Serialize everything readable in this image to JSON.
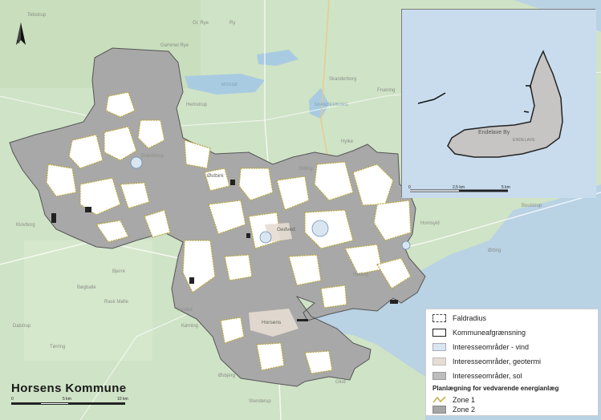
{
  "map": {
    "municipality_label": "Horsens",
    "places": [
      "Tebstrup",
      "Gammel Rye",
      "Ry",
      "Hemstrup",
      "Skanderborg",
      "Fruering",
      "Hylke",
      "Stilling",
      "Gedved",
      "Østbirk",
      "Brædstrup",
      "Klovborg",
      "Bjerre",
      "Hornsyld",
      "Ørting",
      "Hatting",
      "Torsted",
      "Kørning",
      "Rask Mølle",
      "Bøgballe",
      "Dalstrup",
      "Tørring",
      "Øsbjerg",
      "Glud",
      "Stenderup",
      "Gl. Rye",
      "Boulstrup"
    ],
    "lakes": [
      "MOSSØ",
      "SKANDERBORG"
    ]
  },
  "inset": {
    "place": "Endelave By",
    "sublabel": "ENDELAVE",
    "scale": {
      "labels": [
        "0",
        "2,5 km",
        "5 km"
      ]
    }
  },
  "brand": {
    "name": "Horsens Kommune"
  },
  "scalebar": {
    "labels": [
      "0",
      "5 km",
      "10 km"
    ]
  },
  "north": {
    "label": "N"
  },
  "legend": {
    "items": [
      {
        "label": "Faldradius",
        "swatch": "dashed"
      },
      {
        "label": "Kommuneafgrænsning",
        "swatch": "outline"
      },
      {
        "label": "Interesseområder - vind",
        "swatch": "#d9e6f2"
      },
      {
        "label": "Interesseområder, geotermi",
        "swatch": "#e6ddd2"
      },
      {
        "label": "Interesseområder, sol",
        "swatch": "#bdbdbd"
      }
    ],
    "section_title": "Planlægning for vedvarende energianlæg",
    "zones": [
      {
        "label": "Zone 1",
        "color": "#c9b24a"
      },
      {
        "label": "Zone 2",
        "color": "#a6a6a6"
      }
    ]
  },
  "colors": {
    "land": "#cfe3c6",
    "water": "#b9d2e4",
    "municipality": "#a8a8a8",
    "zone1_outline": "#b7a640",
    "white_area": "#ffffff"
  }
}
